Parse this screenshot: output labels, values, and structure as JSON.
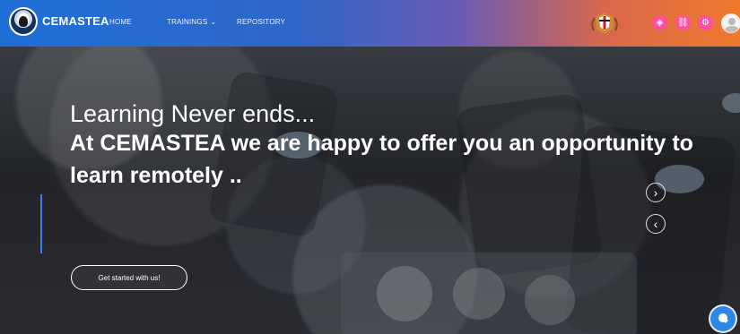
{
  "header": {
    "brand": "CEMASTEA",
    "nav": {
      "home": "HOME",
      "trainings": "TRAININGS",
      "repository": "REPOSITORY"
    }
  },
  "hero": {
    "line1": "Learning Never ends...",
    "line2": "At CEMASTEA we are happy to offer you an opportunity to learn remotely ..",
    "cta": "Get started with us!"
  },
  "controls": {
    "next": "›",
    "prev": "‹"
  },
  "icons": {
    "dropdown": "chevron-down-icon",
    "quick1": "diamond-icon",
    "quick2": "link-icon",
    "quick3": "gear-icon",
    "user": "avatar-icon",
    "coat_of_arms": "coat-of-arms-icon",
    "chat": "chat-icon"
  },
  "colors": {
    "nav_left": "#1f6fd6",
    "nav_right": "#f07a2c",
    "pill": "#ff4fa2",
    "chat": "#2c86e7",
    "accent": "#3f7df3"
  }
}
